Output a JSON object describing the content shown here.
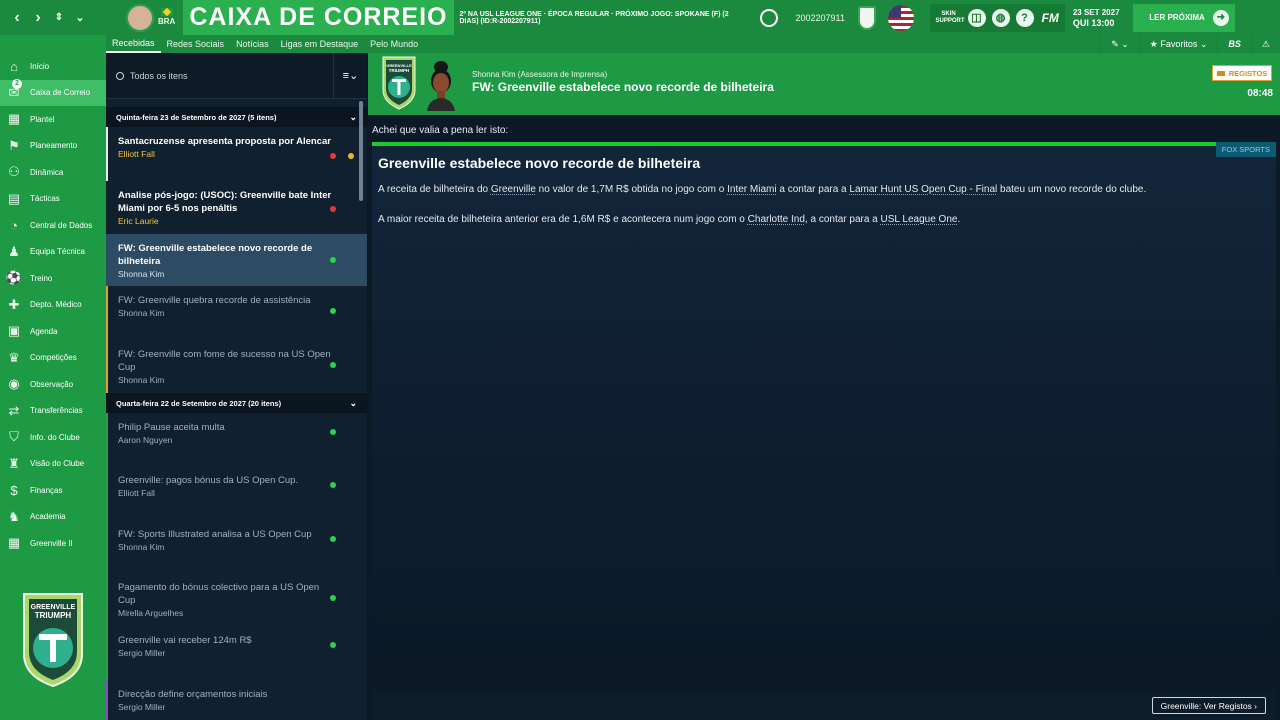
{
  "header": {
    "page_title": "CAIXA DE CORREIO",
    "subtitle": "2º NA USL LEAGUE ONE · ÉPOCA REGULAR · PRÓXIMO JOGO: SPOKANE (F) (2 DIAS) (ID:R-2002207911)",
    "nationality": "BRA",
    "club_code": "2002207911",
    "skin_label_1": "SKIN",
    "skin_label_2": "SUPPORT",
    "fm_logo": "FM",
    "date": "23 SET 2027",
    "time": "QUI 13:00",
    "continue_label": "LER PRÓXIMA",
    "help_icon": "?"
  },
  "subnav": {
    "tabs": [
      "Recebidas",
      "Redes Sociais",
      "Notícias",
      "Ligas em Destaque",
      "Pelo Mundo"
    ],
    "favourites": "★ Favoritos ⌄",
    "bs": "BS"
  },
  "sidebar": {
    "inbox_count": "2",
    "items": [
      "Início",
      "Caixa de Correio",
      "Plantel",
      "Planeamento",
      "Dinâmica",
      "Tácticas",
      "Central de Dados",
      "Equipa Técnica",
      "Treino",
      "Depto. Médico",
      "Agenda",
      "Competições",
      "Observação",
      "Transferências",
      "Info. do Clube",
      "Visão do Clube",
      "Finanças",
      "Academia",
      "Greenville II"
    ],
    "crest_text_1": "GREENVILLE",
    "crest_text_2": "TRIUMPH"
  },
  "inbox": {
    "search_placeholder": "Todos os itens",
    "groups": [
      {
        "label": "Quinta-feira 23 de Setembro de 2027 (5 itens)"
      },
      {
        "label": "Quarta-feira 22 de Setembro de 2027 (20 itens)"
      }
    ],
    "messages": [
      {
        "subject": "Santacruzense apresenta proposta por Alencar",
        "from": "Elliott Fall"
      },
      {
        "subject": "Analise pós-jogo: (USOC): Greenville bate Inter Miami por 6-5 nos penáltis",
        "from": "Eric Laurie"
      },
      {
        "subject": "FW: Greenville estabelece novo recorde de bilheteira",
        "from": "Shonna Kim"
      },
      {
        "subject": "FW: Greenville quebra recorde de assistência",
        "from": "Shonna Kim"
      },
      {
        "subject": "FW: Greenville com fome de sucesso na US Open Cup",
        "from": "Shonna Kim"
      },
      {
        "subject": "Philip Pause aceita multa",
        "from": "Aaron Nguyen"
      },
      {
        "subject": "Greenville: pagos bónus da US Open Cup.",
        "from": "Elliott Fall"
      },
      {
        "subject": "FW: Sports Illustrated analisa a US Open Cup",
        "from": "Shonna Kim"
      },
      {
        "subject": "Pagamento do bónus colectivo para a US Open Cup",
        "from": "Mirella Arguelhes"
      },
      {
        "subject": "Greenville vai receber 124m R$",
        "from": "Sergio Miller"
      },
      {
        "subject": "Direcção define orçamentos iniciais",
        "from": "Sergio Miller"
      }
    ]
  },
  "message": {
    "sender": "Shonna Kim  (Assessora de Imprensa)",
    "title": "FW: Greenville estabelece novo recorde de bilheteira",
    "registos_label": "REGISTOS",
    "time": "08:48",
    "crest_text_1": "GREENVILLE",
    "crest_text_2": "TRIUMPH",
    "intro": "Achei que valia a pena ler isto:",
    "source": "FOX SPORTS",
    "article_title": "Greenville estabelece novo recorde de bilheteira",
    "p1_a": "A receita de bilheteira do ",
    "p1_club": "Greenville",
    "p1_b": " no valor de 1,7M R$ obtida no jogo com o ",
    "p1_opp": "Inter Miami",
    "p1_c": " a contar para a ",
    "p1_comp": "Lamar Hunt US Open Cup - Final",
    "p1_d": " bateu um novo recorde do clube.",
    "p2_a": "A maior receita de bilheteira anterior era de 1,6M R$ e acontecera num jogo com o ",
    "p2_opp": "Charlotte Ind",
    "p2_b": ", a contar para a ",
    "p2_comp": "USL League One",
    "p2_c": ".",
    "footer_button": "Greenville: Ver Registos ›"
  },
  "colors": {
    "brand_green": "#1e9a45",
    "accent_green": "#1ccc2c",
    "dot_red": "#e03b3b",
    "dot_amber": "#f2b51b",
    "dot_green": "#2bd24a"
  }
}
